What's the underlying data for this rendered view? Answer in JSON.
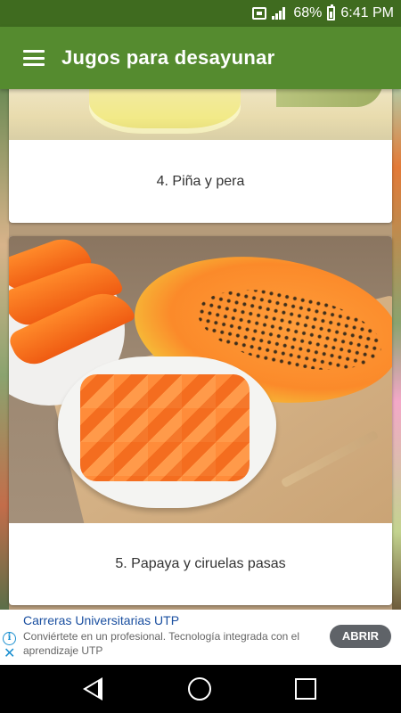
{
  "status_bar": {
    "battery": "68%",
    "time": "6:41 PM"
  },
  "app_bar": {
    "title": "Jugos para desayunar",
    "menu_icon": "menu-icon"
  },
  "cards": [
    {
      "label": "4. Piña y pera",
      "image_icon": "juice-image"
    },
    {
      "label": "5. Papaya y ciruelas pasas",
      "image_icon": "papaya-image"
    }
  ],
  "ad": {
    "title": "Carreras Universitarias UTP",
    "description": "Conviértete en un profesional. Tecnología integrada con el aprendizaje UTP",
    "cta": "ABRIR",
    "info_icon": "info-icon",
    "close_icon": "close-icon"
  },
  "nav_bar": {
    "back_icon": "back-icon",
    "home_icon": "home-icon",
    "recents_icon": "recents-icon"
  },
  "colors": {
    "status_bar": "#3f6b1f",
    "app_bar": "#558b2f",
    "ad_button": "#5f6368",
    "ad_title": "#1a4fa0"
  }
}
